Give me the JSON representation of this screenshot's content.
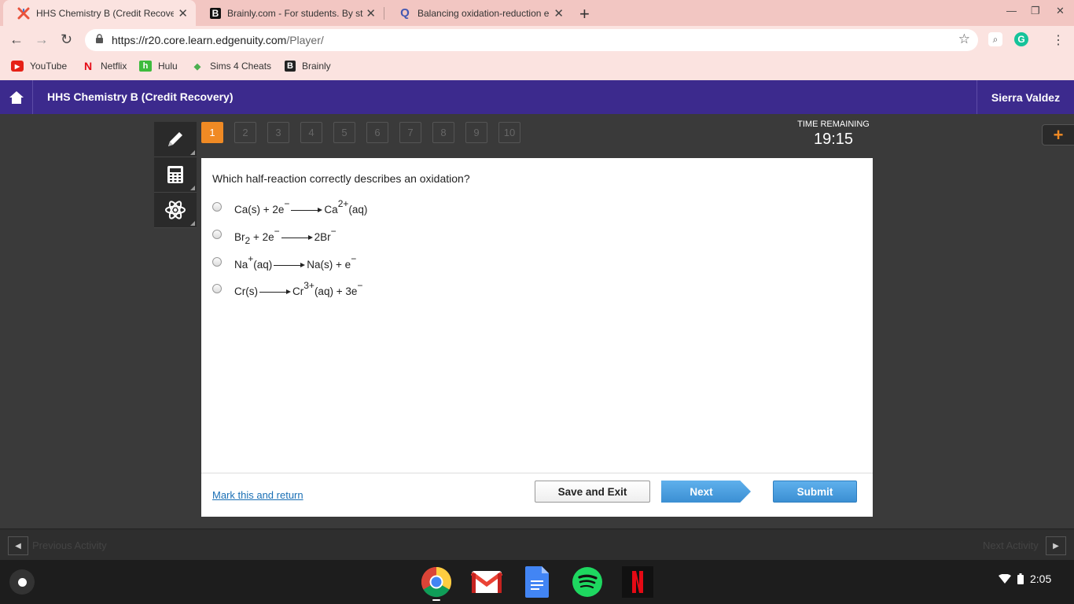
{
  "browser": {
    "tabs": [
      {
        "title": "HHS Chemistry B (Credit Recove",
        "favicon": "edgenuity-x-icon",
        "active": true
      },
      {
        "title": "Brainly.com - For students. By st",
        "favicon": "brainly-b-icon",
        "active": false
      },
      {
        "title": "Balancing oxidation-reduction e",
        "favicon": "quizlet-q-icon",
        "active": false
      }
    ],
    "url_host": "https://r20.core.learn.edgenuity.com",
    "url_path": "/Player/",
    "bookmarks": [
      {
        "label": "YouTube",
        "icon": "youtube-icon",
        "color": "#e62117"
      },
      {
        "label": "Netflix",
        "icon": "netflix-icon",
        "color": "#e50914"
      },
      {
        "label": "Hulu",
        "icon": "hulu-icon",
        "color": "#3dbb3d"
      },
      {
        "label": "Sims 4 Cheats",
        "icon": "plumbob-icon",
        "color": "#4caf50"
      },
      {
        "label": "Brainly",
        "icon": "brainly-icon",
        "color": "#222222"
      }
    ]
  },
  "header": {
    "course_title": "HHS Chemistry B (Credit Recovery)",
    "user_name": "Sierra Valdez"
  },
  "quiz": {
    "question_numbers": [
      "1",
      "2",
      "3",
      "4",
      "5",
      "6",
      "7",
      "8",
      "9",
      "10"
    ],
    "current_question": "1",
    "time_label": "TIME REMAINING",
    "time_value": "19:15",
    "question": "Which half-reaction correctly describes an oxidation?",
    "choices": [
      {
        "lhs": "Ca(s) + 2e",
        "lhs_sup": "−",
        "rhs": "Ca",
        "rhs_sup": "2+",
        "rhs_tail": "(aq)"
      },
      {
        "lhs": "Br",
        "lhs_sub": "2",
        "lhs_tail": " + 2e",
        "lhs_tail_sup": "−",
        "rhs": "2Br",
        "rhs_sup": "−"
      },
      {
        "lhs": "Na",
        "lhs_sup": "+",
        "lhs_tail": "(aq)",
        "rhs": "Na(s) + e",
        "rhs_sup": "−"
      },
      {
        "lhs": "Cr(s)",
        "rhs": "Cr",
        "rhs_sup": "3+",
        "rhs_tail": "(aq) + 3e",
        "rhs_tail_sup": "−"
      }
    ],
    "mark_link": "Mark this and return",
    "save_exit_label": "Save and Exit",
    "next_label": "Next",
    "submit_label": "Submit"
  },
  "activity": {
    "previous_label": "Previous Activity",
    "next_label": "Next Activity"
  },
  "system": {
    "time": "2:05",
    "shelf_apps": [
      "chrome-icon",
      "gmail-icon",
      "google-docs-icon",
      "spotify-icon",
      "netflix-app-icon"
    ]
  },
  "colors": {
    "header_bg": "#3c2a8d",
    "accent_orange": "#f08a24",
    "button_blue": "#3b8fd3",
    "tab_strip": "#f2c6c2"
  }
}
